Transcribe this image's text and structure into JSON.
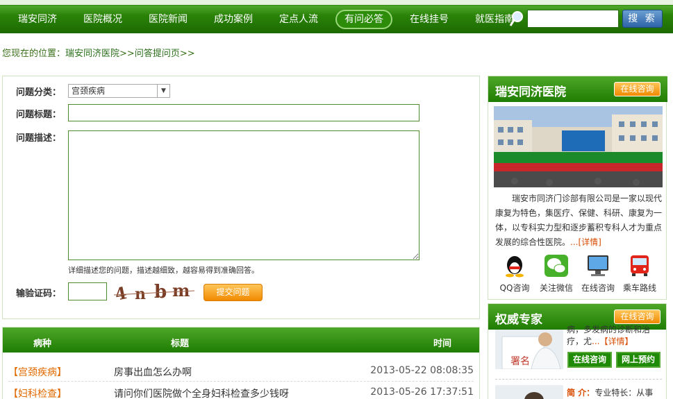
{
  "nav": {
    "items": [
      "瑞安同济",
      "医院概况",
      "医院新闻",
      "成功案例",
      "定点人流",
      "有问必答",
      "在线挂号",
      "就医指南"
    ],
    "active_index": 5,
    "search_value": "",
    "search_button": "搜 索"
  },
  "breadcrumb": {
    "prefix": "您现在的位置：",
    "link1": "瑞安同济医院",
    "sep1": ">>",
    "link2": "问答提问页",
    "sep2": ">>"
  },
  "form": {
    "category_label": "问题分类：",
    "category_value": "宫颈疾病",
    "title_label": "问题标题：",
    "title_value": "",
    "desc_label": "问题描述：",
    "desc_value": "",
    "hint": "详细描述您的问题，描述越细致，越容易得到准确回答。",
    "captcha_label": "输验证码：",
    "captcha_value": "",
    "captcha_text": "4nbm",
    "submit": "提交问题"
  },
  "list": {
    "headers": {
      "category": "病种",
      "title": "标题",
      "time": "时间"
    },
    "rows": [
      {
        "category": "【宫颈疾病】",
        "title": "房事出血怎么办啊",
        "time": "2013-05-22 08:08:35"
      },
      {
        "category": "【妇科检查】",
        "title": "请问你们医院做个全身妇科检查多少钱呀",
        "time": "2013-05-26 17:37:51"
      }
    ]
  },
  "side": {
    "title": "瑞安同济医院",
    "online_button": "在线咨询",
    "intro": "瑞安市同济门诊部有限公司是一家以现代康复为特色，集医疗、保健、科研、康复为一体，以专科实力型和逐步蓄积专科人才为重点发展的综合性医院。",
    "intro_more": "...[详情]",
    "icons": [
      {
        "label": "QQ咨询",
        "icon": "qq-icon"
      },
      {
        "label": "关注微信",
        "icon": "wechat-icon"
      },
      {
        "label": "在线咨询",
        "icon": "monitor-icon"
      },
      {
        "label": "乘车路线",
        "icon": "bus-icon"
      }
    ]
  },
  "experts": {
    "title": "权威专家",
    "online_button": "在线咨询",
    "doc1_text": "病，多发病的诊断和治疗，尤",
    "doc1_more": "...【详情】",
    "consult_button": "在线咨询",
    "booking_button": "网上预约",
    "doc2_label": "简  介：",
    "doc2_text": "专业特长：从事"
  }
}
